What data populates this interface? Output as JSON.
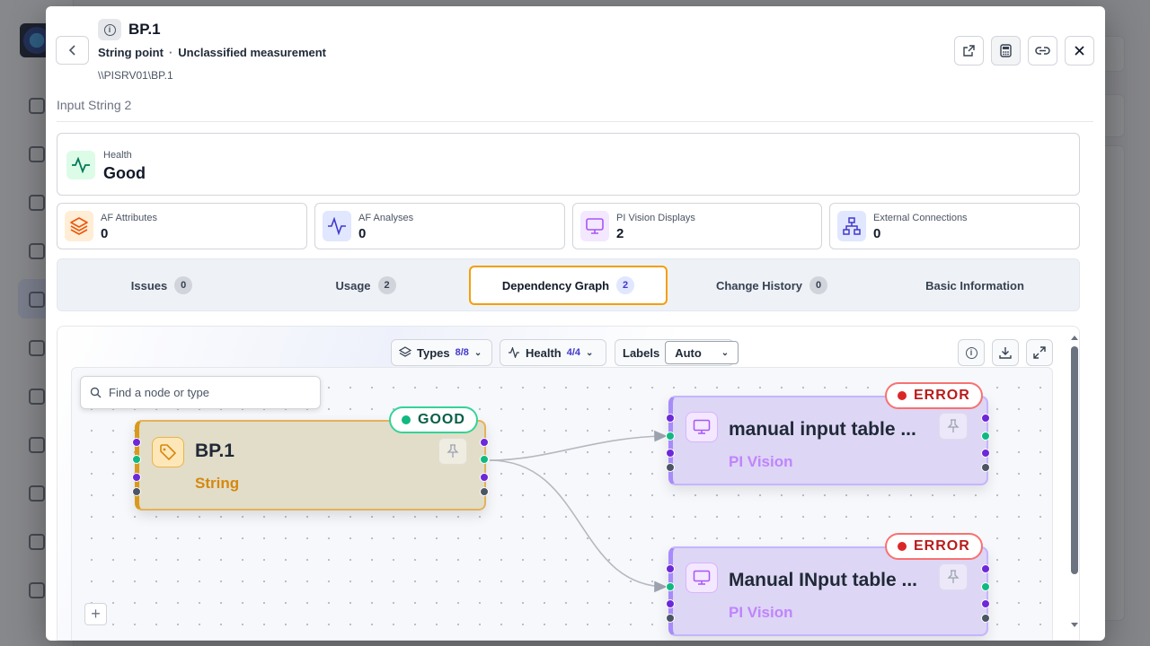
{
  "header": {
    "title": "BP.1",
    "point_type": "String point",
    "separator": "·",
    "classification": "Unclassified measurement",
    "path": "\\\\PISRV01\\BP.1",
    "parent": "Input String 2"
  },
  "health": {
    "label": "Health",
    "value": "Good"
  },
  "stats": [
    {
      "label": "AF Attributes",
      "value": "0",
      "icon": "layers-icon",
      "color": "#ea580c"
    },
    {
      "label": "AF Analyses",
      "value": "0",
      "icon": "pulse-icon",
      "color": "#4338ca"
    },
    {
      "label": "PI Vision Displays",
      "value": "2",
      "icon": "monitor-icon",
      "color": "#a855f7"
    },
    {
      "label": "External Connections",
      "value": "0",
      "icon": "network-icon",
      "color": "#4338ca"
    }
  ],
  "tabs": [
    {
      "label": "Issues",
      "count": "0"
    },
    {
      "label": "Usage",
      "count": "2"
    },
    {
      "label": "Dependency Graph",
      "count": "2",
      "active": true
    },
    {
      "label": "Change History",
      "count": "0"
    },
    {
      "label": "Basic Information",
      "count": ""
    }
  ],
  "graph": {
    "toolbar": {
      "types_label": "Types",
      "types_count": "8/8",
      "health_label": "Health",
      "health_count": "4/4",
      "labels_label": "Labels",
      "labels_value": "Auto"
    },
    "search_placeholder": "Find a node or type",
    "nodes": [
      {
        "title": "BP.1",
        "type": "String",
        "status": "GOOD",
        "status_color": "#10b981"
      },
      {
        "title": "manual input table ...",
        "type": "PI Vision",
        "status": "ERROR",
        "status_color": "#dc2626"
      },
      {
        "title": "Manual INput table ...",
        "type": "PI Vision",
        "status": "ERROR",
        "status_color": "#dc2626"
      }
    ]
  },
  "colors": {
    "accent_tab": "#f59e0b",
    "string_type": "#d4890f",
    "vision_type": "#c084fc"
  }
}
